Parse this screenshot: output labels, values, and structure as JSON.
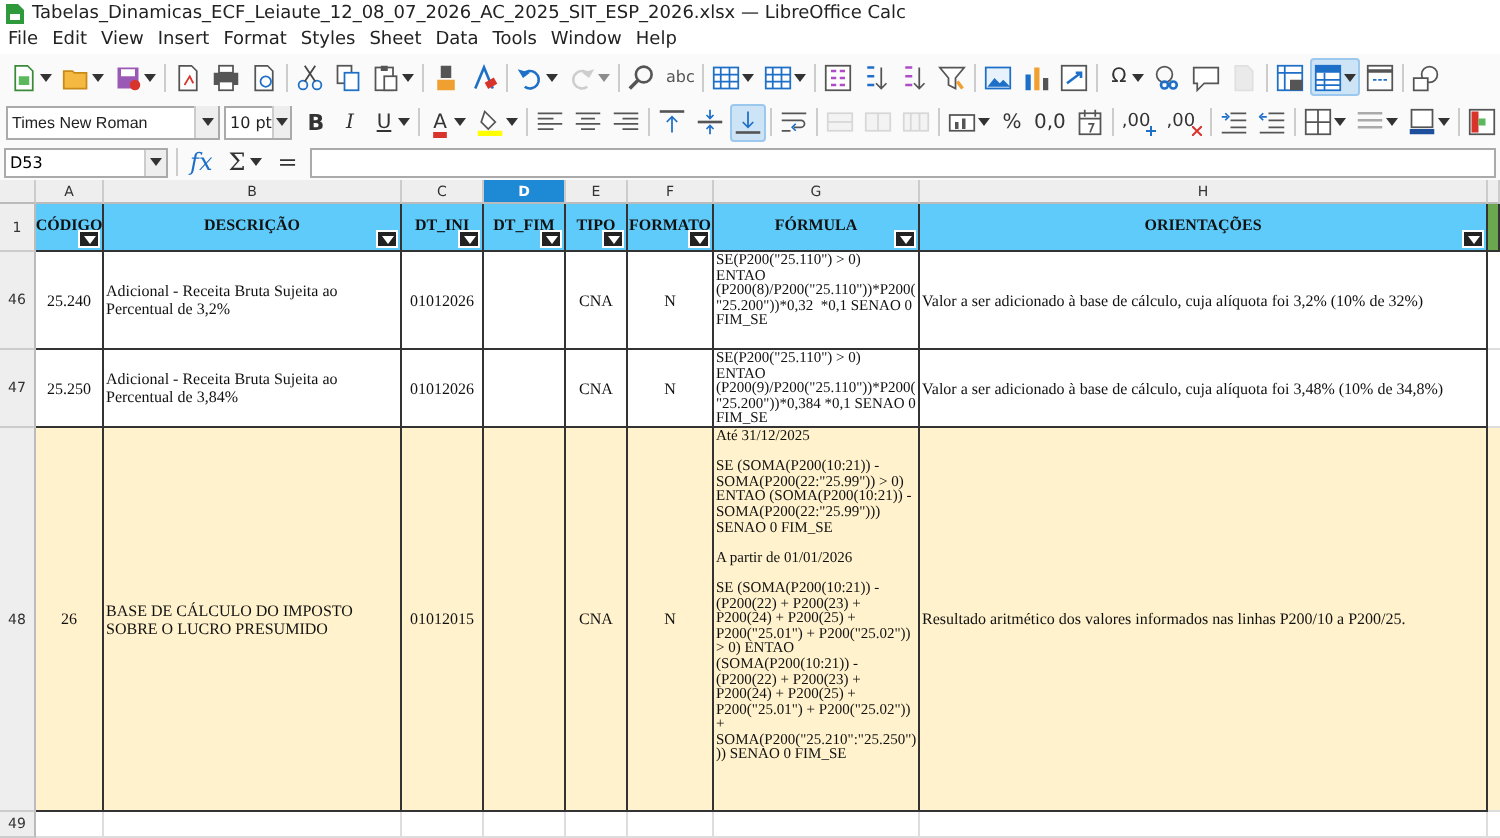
{
  "window": {
    "title": "Tabelas_Dinamicas_ECF_Leiaute_12_08_07_2026_AC_2025_SIT_ESP_2026.xlsx — LibreOffice Calc"
  },
  "menu": [
    "File",
    "Edit",
    "View",
    "Insert",
    "Format",
    "Styles",
    "Sheet",
    "Data",
    "Tools",
    "Window",
    "Help"
  ],
  "standard_toolbar": [
    [
      {
        "kind": "new",
        "dropdown": true,
        "selected": false,
        "disabled": false
      },
      {
        "kind": "open",
        "dropdown": true,
        "selected": false,
        "disabled": false
      },
      {
        "kind": "save",
        "dropdown": true,
        "selected": false,
        "disabled": false
      }
    ],
    [
      {
        "kind": "export-pdf",
        "dropdown": false,
        "selected": false,
        "disabled": false
      },
      {
        "kind": "print",
        "dropdown": false,
        "selected": false,
        "disabled": false
      },
      {
        "kind": "print-preview",
        "dropdown": false,
        "selected": false,
        "disabled": false
      }
    ],
    [
      {
        "kind": "cut",
        "dropdown": false,
        "selected": false,
        "disabled": false
      },
      {
        "kind": "copy",
        "dropdown": false,
        "selected": false,
        "disabled": false
      },
      {
        "kind": "paste",
        "dropdown": true,
        "selected": false,
        "disabled": false
      }
    ],
    [
      {
        "kind": "clone-format",
        "dropdown": false,
        "selected": false,
        "disabled": false
      },
      {
        "kind": "clear-format",
        "dropdown": false,
        "selected": false,
        "disabled": false
      }
    ],
    [
      {
        "kind": "undo",
        "dropdown": true,
        "selected": false,
        "disabled": false
      },
      {
        "kind": "redo",
        "dropdown": true,
        "selected": false,
        "disabled": true
      }
    ],
    [
      {
        "kind": "find",
        "dropdown": false,
        "selected": false,
        "disabled": false
      },
      {
        "kind": "spelling",
        "glyph": "abc",
        "dropdown": false,
        "selected": false,
        "disabled": false
      }
    ],
    [
      {
        "kind": "row",
        "dropdown": true,
        "selected": false,
        "disabled": false
      },
      {
        "kind": "column",
        "dropdown": true,
        "selected": false,
        "disabled": false
      }
    ],
    [
      {
        "kind": "sort",
        "dropdown": false,
        "selected": false,
        "disabled": false
      },
      {
        "kind": "sort-ascending",
        "dropdown": false,
        "selected": false,
        "disabled": false
      },
      {
        "kind": "sort-descending",
        "dropdown": false,
        "selected": false,
        "disabled": false
      },
      {
        "kind": "filter",
        "dropdown": false,
        "selected": false,
        "disabled": false
      }
    ],
    [
      {
        "kind": "image",
        "dropdown": false,
        "selected": false,
        "disabled": false
      },
      {
        "kind": "chart",
        "dropdown": false,
        "selected": false,
        "disabled": false
      },
      {
        "kind": "pivot-table",
        "dropdown": false,
        "selected": false,
        "disabled": false
      }
    ],
    [
      {
        "kind": "special-character",
        "glyph": "Ω",
        "dropdown": true,
        "selected": false,
        "disabled": false
      },
      {
        "kind": "hyperlink",
        "dropdown": false,
        "selected": false,
        "disabled": false
      },
      {
        "kind": "comment",
        "dropdown": false,
        "selected": false,
        "disabled": false
      },
      {
        "kind": "header-footer",
        "dropdown": false,
        "selected": false,
        "disabled": true
      }
    ],
    [
      {
        "kind": "print-area",
        "dropdown": false,
        "selected": false,
        "disabled": false
      },
      {
        "kind": "freeze",
        "dropdown": true,
        "selected": true,
        "disabled": false
      },
      {
        "kind": "split-window",
        "dropdown": false,
        "selected": false,
        "disabled": false
      }
    ],
    [
      {
        "kind": "shapes",
        "dropdown": false,
        "selected": false,
        "disabled": false
      }
    ]
  ],
  "formatting_toolbar": {
    "font_name": "Times New Roman",
    "font_size": "10 pt",
    "groups": [
      [
        {
          "kind": "bold",
          "glyph": "B",
          "dropdown": false,
          "selected": false,
          "disabled": false
        },
        {
          "kind": "italic",
          "glyph": "I",
          "dropdown": false,
          "selected": false,
          "disabled": false
        },
        {
          "kind": "underline",
          "glyph": "U",
          "dropdown": true,
          "selected": false,
          "disabled": false
        }
      ],
      [
        {
          "kind": "font-color",
          "glyph": "A",
          "dropdown": true,
          "selected": false,
          "disabled": false
        },
        {
          "kind": "highlight",
          "dropdown": true,
          "selected": false,
          "disabled": false
        }
      ],
      [
        {
          "kind": "align-left",
          "dropdown": false,
          "selected": false,
          "disabled": false
        },
        {
          "kind": "align-center",
          "dropdown": false,
          "selected": false,
          "disabled": false
        },
        {
          "kind": "align-right",
          "dropdown": false,
          "selected": false,
          "disabled": false
        }
      ],
      [
        {
          "kind": "align-top",
          "dropdown": false,
          "selected": false,
          "disabled": false
        },
        {
          "kind": "align-middle",
          "dropdown": false,
          "selected": false,
          "disabled": false
        },
        {
          "kind": "align-bottom",
          "dropdown": false,
          "selected": true,
          "disabled": false
        }
      ],
      [
        {
          "kind": "wrap",
          "dropdown": false,
          "selected": false,
          "disabled": false
        }
      ],
      [
        {
          "kind": "merge-center",
          "dropdown": false,
          "selected": false,
          "disabled": true
        },
        {
          "kind": "merge",
          "dropdown": false,
          "selected": false,
          "disabled": true
        },
        {
          "kind": "unmerge",
          "dropdown": false,
          "selected": false,
          "disabled": true
        }
      ],
      [
        {
          "kind": "currency",
          "dropdown": true,
          "selected": false,
          "disabled": false
        },
        {
          "kind": "percent",
          "glyph": "%",
          "dropdown": false,
          "selected": false,
          "disabled": false
        },
        {
          "kind": "number",
          "glyph": "0,0",
          "dropdown": false,
          "selected": false,
          "disabled": false
        },
        {
          "kind": "date",
          "dropdown": false,
          "selected": false,
          "disabled": false
        }
      ],
      [
        {
          "kind": "add-decimal",
          "glyph": ",00",
          "dropdown": false,
          "selected": false,
          "disabled": false
        },
        {
          "kind": "delete-decimal",
          "glyph": ",00",
          "dropdown": false,
          "selected": false,
          "disabled": false
        }
      ],
      [
        {
          "kind": "indent",
          "dropdown": false,
          "selected": false,
          "disabled": false
        },
        {
          "kind": "outdent",
          "dropdown": false,
          "selected": false,
          "disabled": false
        }
      ],
      [
        {
          "kind": "borders",
          "dropdown": true,
          "selected": false,
          "disabled": false
        },
        {
          "kind": "border-style",
          "dropdown": true,
          "selected": false,
          "disabled": false
        },
        {
          "kind": "border-color",
          "dropdown": true,
          "selected": false,
          "disabled": false
        }
      ],
      [
        {
          "kind": "conditional",
          "dropdown": false,
          "selected": false,
          "disabled": false
        }
      ]
    ]
  },
  "formula_bar": {
    "name_box": "D53",
    "function_glyph": "fx",
    "sum_glyph": "Σ",
    "equals_glyph": "="
  },
  "columns": [
    {
      "label": "A",
      "selected": false
    },
    {
      "label": "B",
      "selected": false
    },
    {
      "label": "C",
      "selected": false
    },
    {
      "label": "D",
      "selected": true
    },
    {
      "label": "E",
      "selected": false
    },
    {
      "label": "F",
      "selected": false
    },
    {
      "label": "G",
      "selected": false
    },
    {
      "label": "H",
      "selected": false
    }
  ],
  "rows": [
    {
      "number": "1",
      "kind": "header",
      "color": "#5ecbfa",
      "cells": {
        "A": "CÓDIGO",
        "B": "DESCRIÇÃO",
        "C": "DT_INI",
        "D": "DT_FIM",
        "E": "TIPO",
        "F": "FORMATO",
        "G": "FÓRMULA",
        "H": "ORIENTAÇÕES"
      }
    },
    {
      "number": "46",
      "kind": "data",
      "color": "#ffffff",
      "cells": {
        "A": "25.240",
        "B": "Adicional - Receita Bruta Sujeita ao Percentual de 3,2%",
        "C": "01012026",
        "E": "CNA",
        "F": "N",
        "G": "SE(P200(\"25.110\") > 0)\nENTAO\n(P200(8)/P200(\"25.110\"))*P200(\n\"25.200\"))*0,32  *0,1 SENAO 0\nFIM_SE",
        "H": "Valor a ser adicionado à base de cálculo, cuja alíquota foi 3,2% (10% de 32%)"
      }
    },
    {
      "number": "47",
      "kind": "data",
      "color": "#ffffff",
      "cells": {
        "A": "25.250",
        "B": "Adicional - Receita Bruta Sujeita ao Percentual de 3,84%",
        "C": "01012026",
        "E": "CNA",
        "F": "N",
        "G": "SE(P200(\"25.110\") > 0)\nENTAO\n(P200(9)/P200(\"25.110\"))*P200(\n\"25.200\"))*0,384 *0,1 SENAO 0\nFIM_SE",
        "H": "Valor a ser adicionado à base de cálculo, cuja alíquota foi 3,48% (10% de 34,8%)"
      }
    },
    {
      "number": "48",
      "kind": "data",
      "color": "#fff2cc",
      "cells": {
        "A": "26",
        "B": "BASE DE CÁLCULO DO IMPOSTO SOBRE O LUCRO PRESUMIDO",
        "C": "01012015",
        "E": "CNA",
        "F": "N",
        "G": "Até 31/12/2025\n\nSE (SOMA(P200(10:21)) -\nSOMA(P200(22:\"25.99\")) > 0)\nENTAO (SOMA(P200(10:21)) -\nSOMA(P200(22:\"25.99\")))\nSENAO 0 FIM_SE\n\nA partir de 01/01/2026\n\nSE (SOMA(P200(10:21)) -\n(P200(22) + P200(23) +\nP200(24) + P200(25) +\nP200(\"25.01\") + P200(\"25.02\"))\n> 0) ENTAO\n(SOMA(P200(10:21)) -\n(P200(22) + P200(23) +\nP200(24) + P200(25) +\nP200(\"25.01\") + P200(\"25.02\"))\n+\nSOMA(P200(\"25.210\":\"25.250\")\n)) SENAO 0 FIM_SE",
        "H": "Resultado aritmético dos valores informados nas linhas P200/10 a P200/25."
      }
    },
    {
      "number": "49",
      "kind": "empty",
      "color": "#ffffff",
      "cells": {}
    }
  ]
}
